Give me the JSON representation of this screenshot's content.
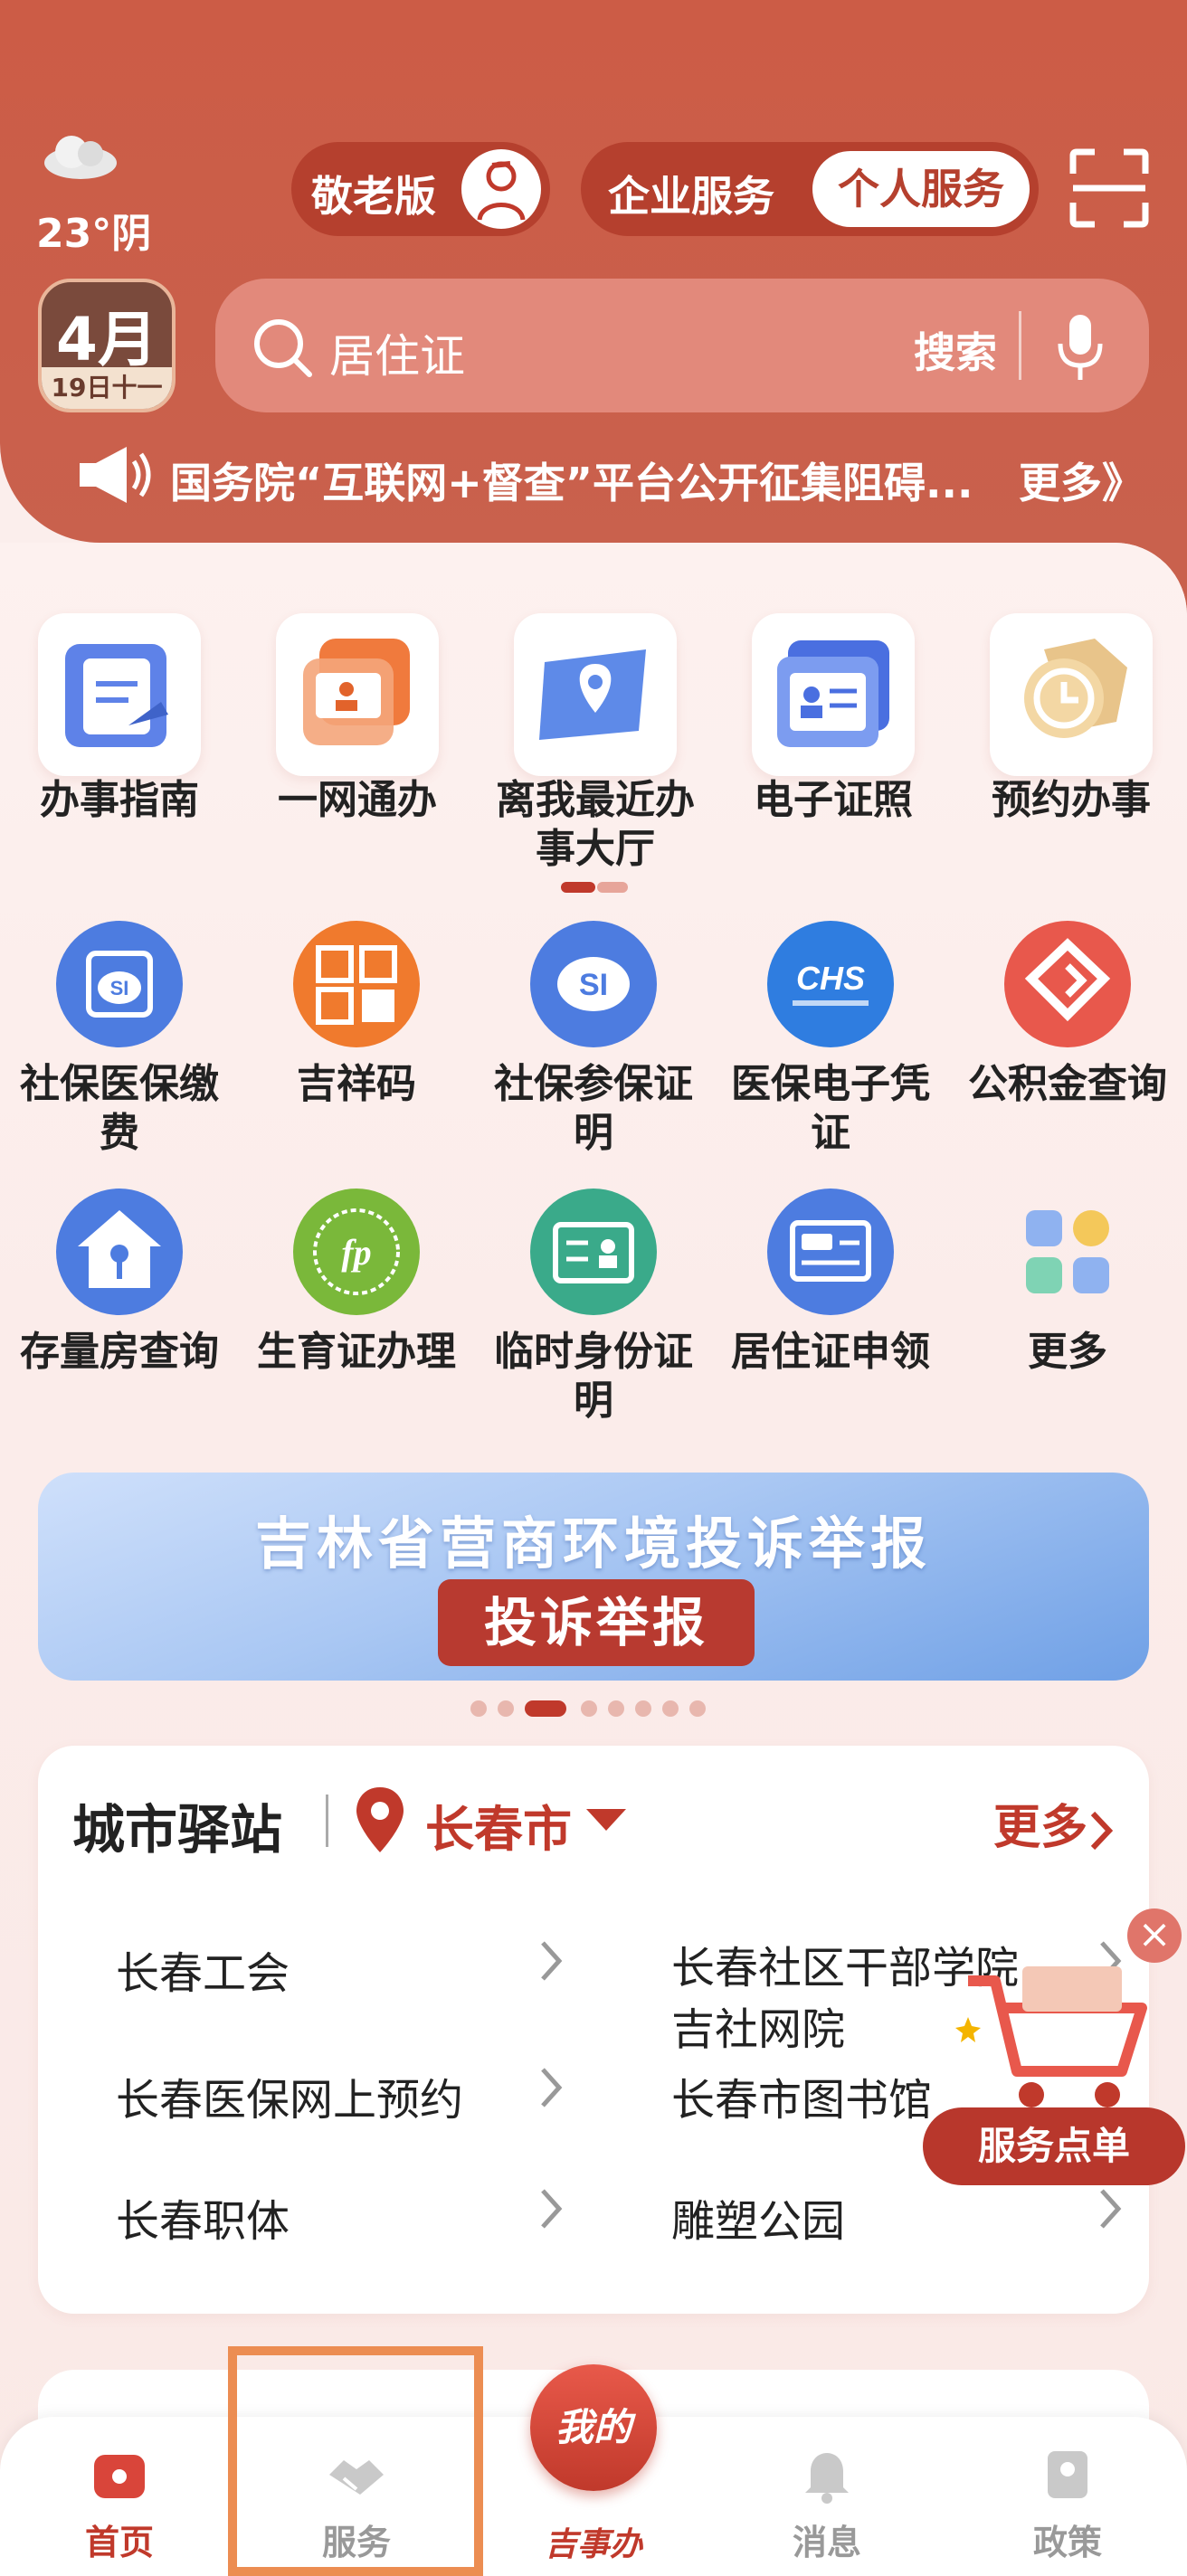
{
  "weather": {
    "temp": "23°阴"
  },
  "header": {
    "senior_label": "敬老版",
    "enterprise_label": "企业服务",
    "personal_label": "个人服务"
  },
  "date": {
    "month": "4月",
    "day": "19日十一"
  },
  "search": {
    "query": "居住证",
    "button": "搜索"
  },
  "notice": {
    "text": "国务院“互联网+督查”平台公开征集阻碍...",
    "more": "更多》"
  },
  "grid1": [
    {
      "label": "办事指南"
    },
    {
      "label": "一网通办"
    },
    {
      "label": "离我最近办事大厅"
    },
    {
      "label": "电子证照"
    },
    {
      "label": "预约办事"
    }
  ],
  "grid2": [
    {
      "label": "社保医保缴费"
    },
    {
      "label": "吉祥码"
    },
    {
      "label": "社保参保证明"
    },
    {
      "label": "医保电子凭证"
    },
    {
      "label": "公积金查询"
    },
    {
      "label": "存量房查询"
    },
    {
      "label": "生育证办理"
    },
    {
      "label": "临时身份证明"
    },
    {
      "label": "居住证申领"
    },
    {
      "label": "更多"
    }
  ],
  "banner": {
    "title": "吉林省营商环境投诉举报",
    "button": "投诉举报"
  },
  "city": {
    "title": "城市驿站",
    "location": "长春市",
    "more": "更多",
    "links": [
      "长春工会",
      "长春社区干部学院吉社网院",
      "长春医保网上预约",
      "长春市图书馆",
      "长春职体",
      "雕塑公园"
    ]
  },
  "float": {
    "label": "服务点单",
    "close": "×"
  },
  "tabs": {
    "home": "首页",
    "service": "服务",
    "center": "我的",
    "center_sub": "吉事办",
    "message": "消息",
    "policy": "政策"
  },
  "colors": {
    "brand": "#c0392b",
    "header": "#cc5c46",
    "highlight": "#ec8d52"
  }
}
